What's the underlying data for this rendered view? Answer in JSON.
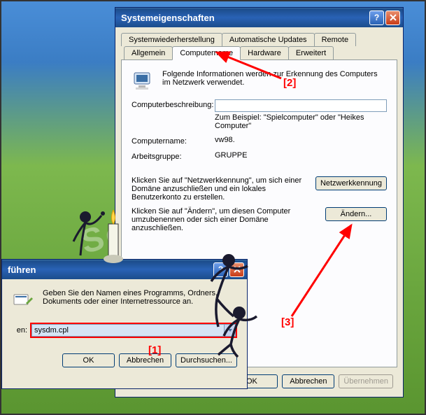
{
  "watermark": "SoftWareOK.de",
  "sysprop": {
    "title": "Systemeigenschaften",
    "tabs_row1": [
      "Systemwiederherstellung",
      "Automatische Updates",
      "Remote"
    ],
    "tabs_row2": [
      "Allgemein",
      "Computername",
      "Hardware",
      "Erweitert"
    ],
    "active_tab": "Computername",
    "intro": "Folgende Informationen werden zur Erkennung des Computers im Netzwerk verwendet.",
    "desc_label": "Computerbeschreibung:",
    "desc_value": "",
    "desc_hint": "Zum Beispiel: \"Spielcomputer\" oder \"Heikes Computer\"",
    "name_label": "Computername:",
    "name_value": "vw98.",
    "group_label": "Arbeitsgruppe:",
    "group_value": "GRUPPE",
    "netid_text": "Klicken Sie auf \"Netzwerkkennung\", um sich einer Domäne anzuschließen und ein lokales Benutzerkonto zu erstellen.",
    "netid_btn": "Netzwerkkennung",
    "change_text": "Klicken Sie auf \"Ändern\", um diesen Computer umzubenennen oder sich einer Domäne anzuschließen.",
    "change_btn": "Ändern...",
    "ok": "OK",
    "cancel": "Abbrechen",
    "apply": "Übernehmen"
  },
  "run": {
    "title": "führen",
    "text": "Geben Sie den Namen eines Programms, Ordners, Dokuments oder einer Internetressource an.",
    "label": "en:",
    "value": "sysdm.cpl",
    "ok": "OK",
    "cancel": "Abbrechen",
    "browse": "Durchsuchen..."
  },
  "annotations": {
    "a1": "[1]",
    "a2": "[2]",
    "a3": "[3]"
  }
}
